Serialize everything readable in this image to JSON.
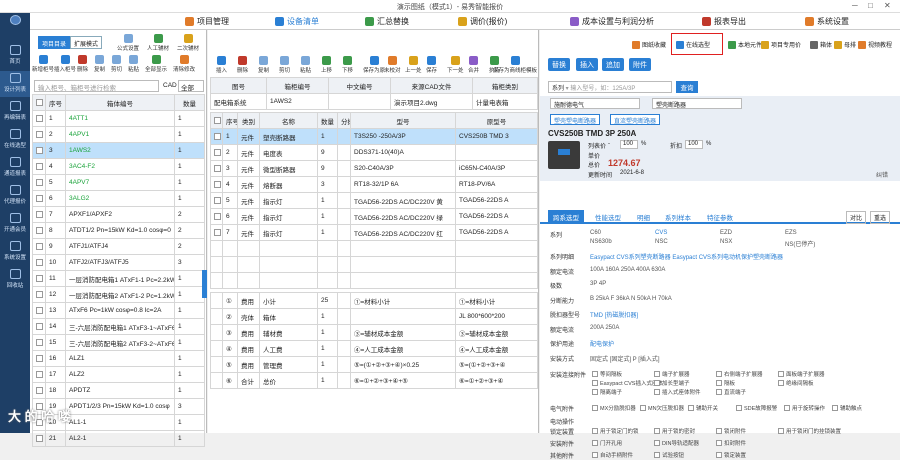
{
  "app": {
    "title": "演示图纸（模式1）- 易秀智能报价"
  },
  "menu": [
    "项目管理",
    "设备清单",
    "汇总替换",
    "调价(报价)",
    "成本设置与利润分析",
    "报表导出",
    "系统设置"
  ],
  "nav": [
    "首页",
    "设计列表",
    "再编辑表",
    "在线选型",
    "通道报表",
    "代理报价",
    "开通会员",
    "系统设置",
    "回收站"
  ],
  "left": {
    "tabs": [
      "项目目录",
      "扩展模式"
    ],
    "tools1": [
      "公式设置",
      "人工辅材",
      "二次辅材",
      "商线柜横板",
      "界面设置",
      "公式修复"
    ],
    "tools2": [
      "新增柜号",
      "插入柜号",
      "删除",
      "复制",
      "剪切",
      "粘贴",
      "全部显示",
      "清除修改"
    ],
    "search_placeholder": "输入柜号、箱柜号进行检索",
    "cad_label": "CAD",
    "cad_value": "全部",
    "headers": [
      "序号",
      "箱体编号",
      "数量"
    ],
    "rows": [
      {
        "n": "1",
        "name": "4ATT1",
        "qty": "1",
        "green": true
      },
      {
        "n": "2",
        "name": "4APV1",
        "qty": "1",
        "green": true
      },
      {
        "n": "3",
        "name": "1AWS2",
        "qty": "1",
        "green": true,
        "sel": true
      },
      {
        "n": "4",
        "name": "3AC4-F2",
        "qty": "1",
        "green": true
      },
      {
        "n": "5",
        "name": "4APV7",
        "qty": "1",
        "green": true
      },
      {
        "n": "6",
        "name": "3ALG2",
        "qty": "1",
        "green": true
      },
      {
        "n": "7",
        "name": "APXF1/APXF2",
        "qty": "2",
        "green": false
      },
      {
        "n": "8",
        "name": "ATDT1/2 Pn=15kW Kd=1.0 cosφ=0",
        "qty": "2",
        "green": false
      },
      {
        "n": "9",
        "name": "ATFJ1/ATFJ4",
        "qty": "2",
        "green": false
      },
      {
        "n": "10",
        "name": "ATFJ2/ATFJ3/ATFJ5",
        "qty": "3",
        "green": false
      },
      {
        "n": "11",
        "name": "一层消防配电箱1 ATxF1-1 Pc=2.2kW",
        "qty": "1",
        "green": false
      },
      {
        "n": "12",
        "name": "一层消防配电箱2 ATxF1-2 Pc=1.2kW",
        "qty": "1",
        "green": false
      },
      {
        "n": "13",
        "name": "ATxF6 Pc=1kW cosφ=0.8 Ic=2A",
        "qty": "1",
        "green": false
      },
      {
        "n": "14",
        "name": "三-六层消防配电箱1 ATxF3-1~ATxF6",
        "qty": "1",
        "green": false
      },
      {
        "n": "15",
        "name": "三-六层消防配电箱2 ATxF3-2~ATxF6",
        "qty": "1",
        "green": false
      },
      {
        "n": "16",
        "name": "ALZ1",
        "qty": "1",
        "green": false
      },
      {
        "n": "17",
        "name": "ALZ2",
        "qty": "1",
        "green": false
      },
      {
        "n": "18",
        "name": "APDTZ",
        "qty": "1",
        "green": false
      },
      {
        "n": "19",
        "name": "APDT1/2/3 Pn=15kW Kd=1.0 cosφ",
        "qty": "3",
        "green": false
      },
      {
        "n": "20",
        "name": "AL1-1",
        "qty": "1",
        "green": false
      },
      {
        "n": "21",
        "name": "AL2-1",
        "qty": "1",
        "green": false
      }
    ]
  },
  "mid": {
    "tools": [
      "插入",
      "删除",
      "复制",
      "剪切",
      "粘贴",
      "上移",
      "下移",
      "保存为原",
      "未校对",
      "上一处",
      "保存",
      "下一处",
      "合并",
      "执行",
      "保存为商线柜模板"
    ],
    "info_headers": [
      "图号",
      "箱柜编号",
      "中文编号",
      "来源CAD文件",
      "箱柜类别"
    ],
    "info_values": [
      "配电箱系统",
      "1AWS2",
      "",
      "演示项目2.dwg",
      "计量电表箱"
    ],
    "headers": [
      "",
      "序号",
      "类别",
      "名称",
      "数量",
      "分摊",
      "型号",
      "原型号"
    ],
    "rows": [
      {
        "n": "1",
        "cat": "元件",
        "name": "塑壳断路器",
        "qty": "1",
        "model": "T3S250 -250A/3P",
        "orig": "CVS250B TMD 3",
        "sel": true
      },
      {
        "n": "2",
        "cat": "元件",
        "name": "电度表",
        "qty": "9",
        "model": "DDS371-10(40)A",
        "orig": ""
      },
      {
        "n": "3",
        "cat": "元件",
        "name": "微型断路器",
        "qty": "9",
        "model": "S20-C40A/3P",
        "orig": "iC65N-C40A/3P"
      },
      {
        "n": "4",
        "cat": "元件",
        "name": "熔断器",
        "qty": "3",
        "model": "RT18-32/1P 6A",
        "orig": "RT18-PV/6A"
      },
      {
        "n": "5",
        "cat": "元件",
        "name": "指示灯",
        "qty": "1",
        "model": "TGAD56-22DS AC/DC220V 黄",
        "orig": "TGAD56-22DS A"
      },
      {
        "n": "6",
        "cat": "元件",
        "name": "指示灯",
        "qty": "1",
        "model": "TGAD56-22DS AC/DC220V 绿",
        "orig": "TGAD56-22DS A"
      },
      {
        "n": "7",
        "cat": "元件",
        "name": "指示灯",
        "qty": "1",
        "model": "TGAD56-22DS AC/DC220V 红",
        "orig": "TGAD56-22DS A"
      }
    ],
    "summary": [
      {
        "n": "①",
        "cat": "费用",
        "name": "小计",
        "qty": "25",
        "model": "①=材料小计",
        "orig": "①=材料小计"
      },
      {
        "n": "②",
        "cat": "壳体",
        "name": "箱体",
        "qty": "1",
        "model": "",
        "orig": "JL 800*600*200"
      },
      {
        "n": "③",
        "cat": "费用",
        "name": "辅材费",
        "qty": "1",
        "model": "③=辅材成本金额",
        "orig": "③=辅材成本金额"
      },
      {
        "n": "④",
        "cat": "费用",
        "name": "人工费",
        "qty": "1",
        "model": "④=人工成本金额",
        "orig": "④=人工成本金额"
      },
      {
        "n": "⑤",
        "cat": "费用",
        "name": "管理费",
        "qty": "1",
        "model": "⑤=(①+②+③+④)×0.25",
        "orig": "⑤=(①+②+③+④"
      },
      {
        "n": "⑥",
        "cat": "合计",
        "name": "总价",
        "qty": "1",
        "model": "⑥=①+②+③+④+⑤",
        "orig": "⑥=①+②+③+④"
      }
    ]
  },
  "right": {
    "toolbar": [
      "图纸收藏",
      "在线选型",
      "本地元件",
      "项目专用价",
      "箱体",
      "母排",
      "视频教程"
    ],
    "buttons": [
      "替换",
      "插入",
      "追加",
      "附件"
    ],
    "search_label": "系列",
    "search_placeholder": "输入型号，如：125A/3P",
    "search_btn": "查询",
    "brand": "施耐德电气",
    "category": "塑壳断路器",
    "chips": [
      "塑壳塑电断路器",
      "直流塑壳断路器"
    ],
    "product": {
      "title": "CVS250B TMD 3P 250A",
      "list_price_label": "列表价",
      "list_price": "-",
      "discount_label": "折扣",
      "unit_label": "单价",
      "total_label": "总价",
      "total": "1274.67",
      "date_label": "更新时间",
      "date": "2021-6-8",
      "feedback": "纠错",
      "list_price_pct": "100",
      "discount_pct": "100"
    },
    "tabs": [
      "跨系选型",
      "性能选型",
      "明细",
      "系列样本",
      "特征参数"
    ],
    "tab_btns": [
      "对比",
      "重选"
    ],
    "series_label": "系列",
    "series": [
      "C60",
      "CVS",
      "EZD",
      "EZS",
      "NS630b",
      "NSC",
      "NSX",
      "NS(已停产)"
    ],
    "params": [
      {
        "label": "系列明细",
        "value": "Easypact CVS系列塑壳断路器    Easypact CVS系列电动机保护塑壳断路器"
      },
      {
        "label": "额定电流",
        "value": "100A   160A   250A   400A   630A"
      },
      {
        "label": "极数",
        "value": "3P   4P"
      },
      {
        "label": "分断能力",
        "value": "B 25kA   F 36kA   N 50kA   H 70kA"
      },
      {
        "label": "脱扣器型号",
        "value": "TMD [热磁脱扣器]"
      },
      {
        "label": "额定电流",
        "value": "200A   250A"
      },
      {
        "label": "保护用途",
        "value": "配电保护"
      },
      {
        "label": "安装方式",
        "value": "固定式 [固定式]    P [插入式]"
      }
    ],
    "accessories_label": "安装连接附件",
    "accessories": [
      "等间隔板",
      "端子扩展器",
      "右侧端子扩展器",
      "面板端子扩展器",
      "Easypact CVS插入式座体",
      "加长型端子",
      "隔板",
      "绝缘间隔板",
      "隔离端子",
      "插入式座体附件",
      "直流端子"
    ],
    "electric_label": "电气附件",
    "electric": [
      "MX分励脱扣器",
      "MN欠压脱扣器",
      "辅助开关",
      "SDE故障报警",
      "用于旋转操作",
      "辅助触点"
    ],
    "motor_label": "电动操作",
    "lock_label": "锁定装置",
    "lock": [
      "用于锁定门的锁",
      "用于锁的密封",
      "锁闭附件",
      "用于锁闭门的挂锁装置"
    ],
    "install_label": "安装附件",
    "install": [
      "门开孔用",
      "DIN导轨适配器",
      "扣封附件"
    ],
    "other_label": "其他附件",
    "other": [
      "自动手柄附件",
      "试验按钮",
      "锁定装置"
    ]
  },
  "watermark": "大 的 哈 喽"
}
